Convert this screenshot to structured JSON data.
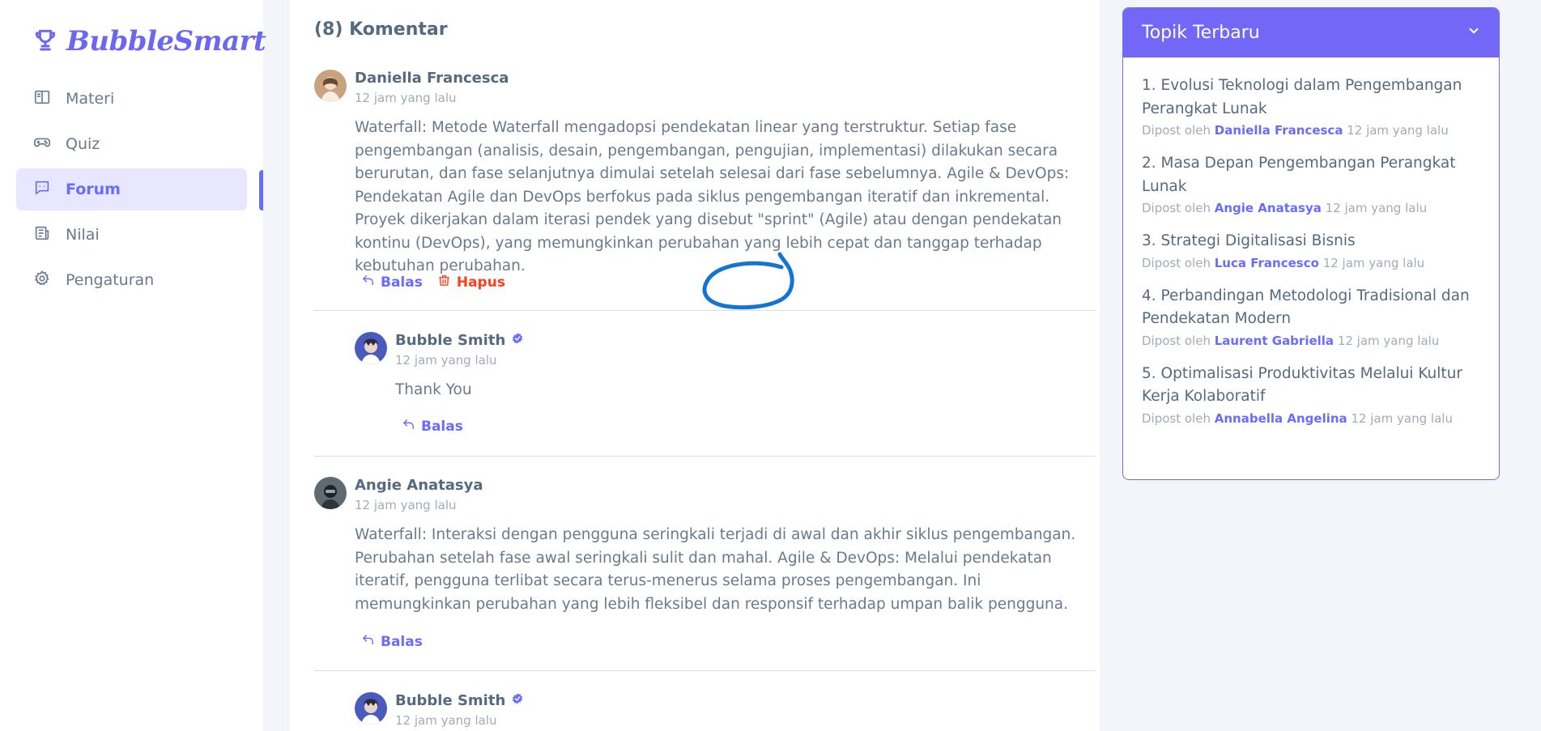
{
  "app": {
    "name": "BubbleSmart",
    "logo_icon": "trophy-icon",
    "accent": "#696cff"
  },
  "sidebar": {
    "items": [
      {
        "label": "Materi",
        "icon": "book-open-icon",
        "active": false
      },
      {
        "label": "Quiz",
        "icon": "gamepad-icon",
        "active": false
      },
      {
        "label": "Forum",
        "icon": "chat-icon",
        "active": true
      },
      {
        "label": "Nilai",
        "icon": "report-icon",
        "active": false
      },
      {
        "label": "Pengaturan",
        "icon": "gear-icon",
        "active": false
      }
    ]
  },
  "comments": {
    "title": "(8) Komentar",
    "list": [
      {
        "author": "Daniella Francesca",
        "time": "12 jam yang lalu",
        "text": "Waterfall: Metode Waterfall mengadopsi pendekatan linear yang terstruktur. Setiap fase pengembangan (analisis, desain, pengembangan, pengujian, implementasi) dilakukan secara berurutan, dan fase selanjutnya dimulai setelah selesai dari fase sebelumnya. Agile & DevOps: Pendekatan Agile dan DevOps berfokus pada siklus pengembangan iteratif dan inkremental. Proyek dikerjakan dalam iterasi pendek yang disebut \"sprint\" (Agile) atau dengan pendekatan kontinu (DevOps), yang memungkinkan perubahan yang lebih cepat dan tanggap terhadap kebutuhan perubahan.",
        "reply_label": "Balas",
        "delete_label": "Hapus"
      },
      {
        "author": "Bubble Smith",
        "verified": true,
        "time": "12 jam yang lalu",
        "text": "Thank You",
        "reply_label": "Balas"
      },
      {
        "author": "Angie Anatasya",
        "time": "12 jam yang lalu",
        "text": "Waterfall: Interaksi dengan pengguna seringkali terjadi di awal dan akhir siklus pengembangan. Perubahan setelah fase awal seringkali sulit dan mahal. Agile & DevOps: Melalui pendekatan iteratif, pengguna terlibat secara terus-menerus selama proses pengembangan. Ini memungkinkan perubahan yang lebih fleksibel dan responsif terhadap umpan balik pengguna.",
        "reply_label": "Balas"
      },
      {
        "author": "Bubble Smith",
        "verified": true,
        "time": "12 jam yang lalu"
      }
    ]
  },
  "topics": {
    "title": "Topik Terbaru",
    "posted_by": "Dipost oleh",
    "items": [
      {
        "title": "1. Evolusi Teknologi dalam Pengembangan Perangkat Lunak",
        "author": "Daniella Francesca",
        "time": "12 jam yang lalu"
      },
      {
        "title": "2. Masa Depan Pengembangan Perangkat Lunak",
        "author": "Angie Anatasya",
        "time": "12 jam yang lalu"
      },
      {
        "title": "3. Strategi Digitalisasi Bisnis",
        "author": "Luca Francesco",
        "time": "12 jam yang lalu"
      },
      {
        "title": "4. Perbandingan Metodologi Tradisional dan Pendekatan Modern",
        "author": "Laurent Gabriella",
        "time": "12 jam yang lalu"
      },
      {
        "title": "5. Optimalisasi Produktivitas Melalui Kultur Kerja Kolaboratif",
        "author": "Annabella Angelina",
        "time": "12 jam yang lalu"
      }
    ]
  }
}
